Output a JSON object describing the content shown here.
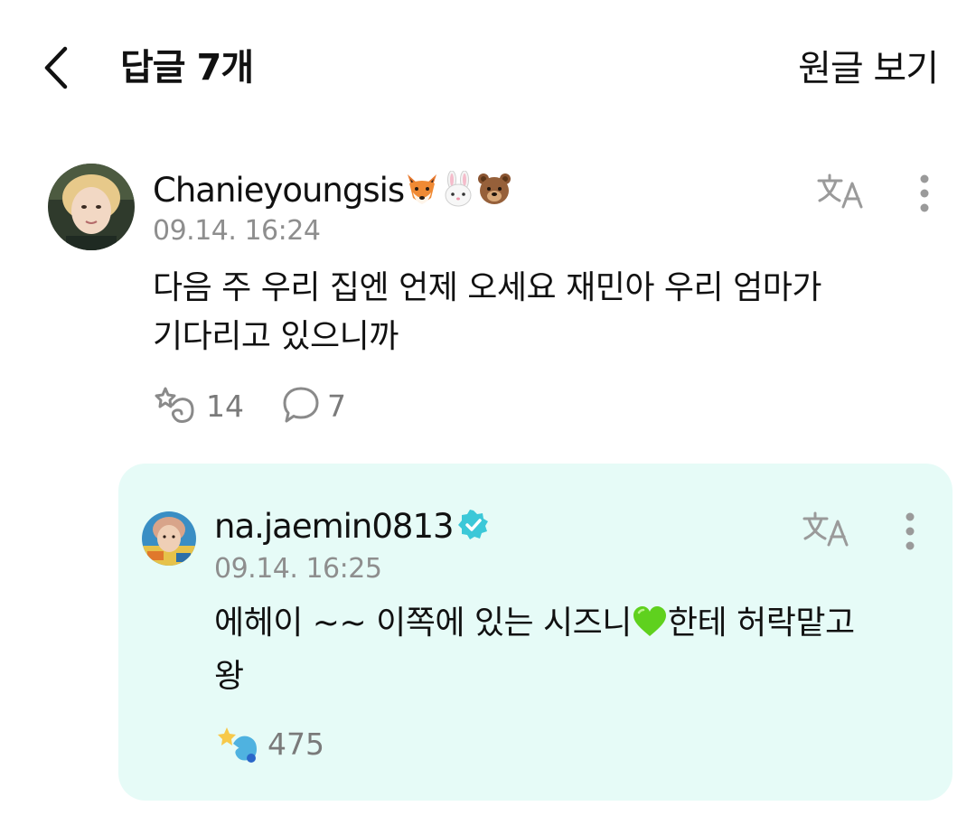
{
  "header": {
    "title": "답글 7개",
    "view_original": "원글 보기"
  },
  "comment": {
    "username": "Chanieyoungsis",
    "timestamp": "09.14. 16:24",
    "text_lines": [
      "다음 주 우리 집엔 언제 오세요 재민아 우리 엄마가",
      "기다리고 있으니까"
    ],
    "like_count": "14",
    "reply_count": "7"
  },
  "reply": {
    "username": "na.jaemin0813",
    "timestamp": "09.14. 16:25",
    "text_line1_before": "에헤이 ~~ 이쪽에 있는 시즈니",
    "text_line1_after": "한테 허락맡고",
    "text_line2": "왕",
    "like_count": "475"
  },
  "colors": {
    "reply_bg": "#e6fbf7",
    "verified": "#3cc8d8",
    "muted": "#8e8e8e"
  }
}
